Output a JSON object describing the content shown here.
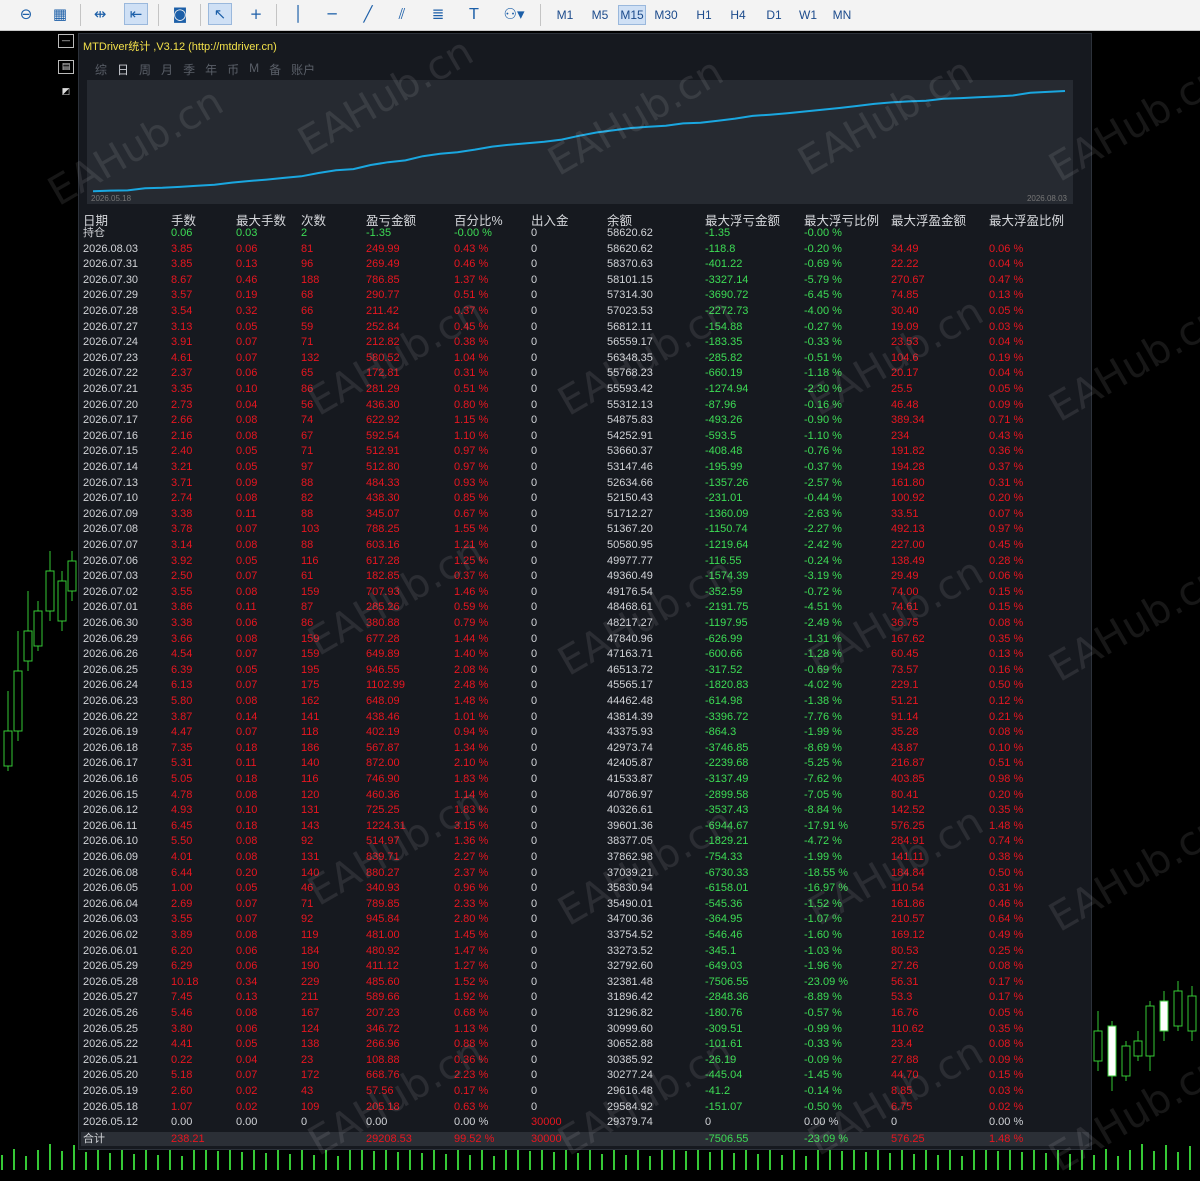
{
  "toolbar": {
    "timeframes": [
      "M1",
      "M5",
      "M15",
      "M30",
      "H1",
      "H4",
      "D1",
      "W1",
      "MN"
    ],
    "active_timeframe": "M15"
  },
  "panel": {
    "title": "MTDriver统计 ,V3.12 (http://mtdriver.cn)",
    "tabs": [
      "综",
      "日",
      "周",
      "月",
      "季",
      "年",
      "币",
      "M",
      "备",
      "账户"
    ],
    "active_tab": "日",
    "equity_start_date": "2026.05.18",
    "equity_end_date": "2026.08.03",
    "equity_color": "#1aa7e0"
  },
  "table": {
    "headers": [
      "日期",
      "手数",
      "最大手数",
      "次数",
      "盈亏金额",
      "百分比%",
      "出入金",
      "余额",
      "最大浮亏金额",
      "最大浮亏比例",
      "最大浮盈金额",
      "最大浮盈比例"
    ],
    "holding": {
      "label": "持仓",
      "lots": "0.06",
      "max_lots": "0.03",
      "count": "2",
      "pl": "-1.35",
      "pct": "-0.00 %",
      "deposit": "0",
      "balance": "58620.62",
      "max_dd": "-1.35",
      "max_dd_pct": "-0.00 %"
    },
    "rows": [
      {
        "date": "2026.08.03",
        "lots": "3.85",
        "max": "0.06",
        "cnt": "81",
        "pl": "249.99",
        "pct": "0.43 %",
        "dep": "0",
        "bal": "58620.62",
        "dd": "-118.8",
        "ddp": "-0.20 %",
        "fp": "34.49",
        "fpp": "0.06 %"
      },
      {
        "date": "2026.07.31",
        "lots": "3.85",
        "max": "0.13",
        "cnt": "96",
        "pl": "269.49",
        "pct": "0.46 %",
        "dep": "0",
        "bal": "58370.63",
        "dd": "-401.22",
        "ddp": "-0.69 %",
        "fp": "22.22",
        "fpp": "0.04 %"
      },
      {
        "date": "2026.07.30",
        "lots": "8.67",
        "max": "0.46",
        "cnt": "188",
        "pl": "786.85",
        "pct": "1.37 %",
        "dep": "0",
        "bal": "58101.15",
        "dd": "-3327.14",
        "ddp": "-5.79 %",
        "fp": "270.67",
        "fpp": "0.47 %"
      },
      {
        "date": "2026.07.29",
        "lots": "3.57",
        "max": "0.19",
        "cnt": "68",
        "pl": "290.77",
        "pct": "0.51 %",
        "dep": "0",
        "bal": "57314.30",
        "dd": "-3690.72",
        "ddp": "-6.45 %",
        "fp": "74.85",
        "fpp": "0.13 %"
      },
      {
        "date": "2026.07.28",
        "lots": "3.54",
        "max": "0.32",
        "cnt": "66",
        "pl": "211.42",
        "pct": "0.37 %",
        "dep": "0",
        "bal": "57023.53",
        "dd": "-2272.73",
        "ddp": "-4.00 %",
        "fp": "30.40",
        "fpp": "0.05 %"
      },
      {
        "date": "2026.07.27",
        "lots": "3.13",
        "max": "0.05",
        "cnt": "59",
        "pl": "252.84",
        "pct": "0.45 %",
        "dep": "0",
        "bal": "56812.11",
        "dd": "-154.88",
        "ddp": "-0.27 %",
        "fp": "19.09",
        "fpp": "0.03 %"
      },
      {
        "date": "2026.07.24",
        "lots": "3.91",
        "max": "0.07",
        "cnt": "71",
        "pl": "212.82",
        "pct": "0.38 %",
        "dep": "0",
        "bal": "56559.17",
        "dd": "-183.35",
        "ddp": "-0.33 %",
        "fp": "23.53",
        "fpp": "0.04 %"
      },
      {
        "date": "2026.07.23",
        "lots": "4.61",
        "max": "0.07",
        "cnt": "132",
        "pl": "580.52",
        "pct": "1.04 %",
        "dep": "0",
        "bal": "56348.35",
        "dd": "-285.82",
        "ddp": "-0.51 %",
        "fp": "104.6",
        "fpp": "0.19 %"
      },
      {
        "date": "2026.07.22",
        "lots": "2.37",
        "max": "0.06",
        "cnt": "65",
        "pl": "172.81",
        "pct": "0.31 %",
        "dep": "0",
        "bal": "55768.23",
        "dd": "-660.19",
        "ddp": "-1.18 %",
        "fp": "20.17",
        "fpp": "0.04 %"
      },
      {
        "date": "2026.07.21",
        "lots": "3.35",
        "max": "0.10",
        "cnt": "86",
        "pl": "281.29",
        "pct": "0.51 %",
        "dep": "0",
        "bal": "55593.42",
        "dd": "-1274.94",
        "ddp": "-2.30 %",
        "fp": "25.5",
        "fpp": "0.05 %"
      },
      {
        "date": "2026.07.20",
        "lots": "2.73",
        "max": "0.04",
        "cnt": "56",
        "pl": "436.30",
        "pct": "0.80 %",
        "dep": "0",
        "bal": "55312.13",
        "dd": "-87.96",
        "ddp": "-0.16 %",
        "fp": "46.48",
        "fpp": "0.09 %"
      },
      {
        "date": "2026.07.17",
        "lots": "2.66",
        "max": "0.08",
        "cnt": "74",
        "pl": "622.92",
        "pct": "1.15 %",
        "dep": "0",
        "bal": "54875.83",
        "dd": "-493.26",
        "ddp": "-0.90 %",
        "fp": "389.34",
        "fpp": "0.71 %"
      },
      {
        "date": "2026.07.16",
        "lots": "2.16",
        "max": "0.08",
        "cnt": "67",
        "pl": "592.54",
        "pct": "1.10 %",
        "dep": "0",
        "bal": "54252.91",
        "dd": "-593.5",
        "ddp": "-1.10 %",
        "fp": "234",
        "fpp": "0.43 %"
      },
      {
        "date": "2026.07.15",
        "lots": "2.40",
        "max": "0.05",
        "cnt": "71",
        "pl": "512.91",
        "pct": "0.97 %",
        "dep": "0",
        "bal": "53660.37",
        "dd": "-408.48",
        "ddp": "-0.76 %",
        "fp": "191.82",
        "fpp": "0.36 %"
      },
      {
        "date": "2026.07.14",
        "lots": "3.21",
        "max": "0.05",
        "cnt": "97",
        "pl": "512.80",
        "pct": "0.97 %",
        "dep": "0",
        "bal": "53147.46",
        "dd": "-195.99",
        "ddp": "-0.37 %",
        "fp": "194.28",
        "fpp": "0.37 %"
      },
      {
        "date": "2026.07.13",
        "lots": "3.71",
        "max": "0.09",
        "cnt": "88",
        "pl": "484.33",
        "pct": "0.93 %",
        "dep": "0",
        "bal": "52634.66",
        "dd": "-1357.26",
        "ddp": "-2.57 %",
        "fp": "161.80",
        "fpp": "0.31 %"
      },
      {
        "date": "2026.07.10",
        "lots": "2.74",
        "max": "0.08",
        "cnt": "82",
        "pl": "438.30",
        "pct": "0.85 %",
        "dep": "0",
        "bal": "52150.43",
        "dd": "-231.01",
        "ddp": "-0.44 %",
        "fp": "100.92",
        "fpp": "0.20 %"
      },
      {
        "date": "2026.07.09",
        "lots": "3.38",
        "max": "0.11",
        "cnt": "88",
        "pl": "345.07",
        "pct": "0.67 %",
        "dep": "0",
        "bal": "51712.27",
        "dd": "-1360.09",
        "ddp": "-2.63 %",
        "fp": "33.51",
        "fpp": "0.07 %"
      },
      {
        "date": "2026.07.08",
        "lots": "3.78",
        "max": "0.07",
        "cnt": "103",
        "pl": "788.25",
        "pct": "1.55 %",
        "dep": "0",
        "bal": "51367.20",
        "dd": "-1150.74",
        "ddp": "-2.27 %",
        "fp": "492.13",
        "fpp": "0.97 %"
      },
      {
        "date": "2026.07.07",
        "lots": "3.14",
        "max": "0.08",
        "cnt": "88",
        "pl": "603.16",
        "pct": "1.21 %",
        "dep": "0",
        "bal": "50580.95",
        "dd": "-1219.64",
        "ddp": "-2.42 %",
        "fp": "227.00",
        "fpp": "0.45 %"
      },
      {
        "date": "2026.07.06",
        "lots": "3.92",
        "max": "0.05",
        "cnt": "116",
        "pl": "617.28",
        "pct": "1.25 %",
        "dep": "0",
        "bal": "49977.77",
        "dd": "-116.55",
        "ddp": "-0.24 %",
        "fp": "138.49",
        "fpp": "0.28 %"
      },
      {
        "date": "2026.07.03",
        "lots": "2.50",
        "max": "0.07",
        "cnt": "61",
        "pl": "182.85",
        "pct": "0.37 %",
        "dep": "0",
        "bal": "49360.49",
        "dd": "-1574.39",
        "ddp": "-3.19 %",
        "fp": "29.49",
        "fpp": "0.06 %"
      },
      {
        "date": "2026.07.02",
        "lots": "3.55",
        "max": "0.08",
        "cnt": "159",
        "pl": "707.93",
        "pct": "1.46 %",
        "dep": "0",
        "bal": "49176.54",
        "dd": "-352.59",
        "ddp": "-0.72 %",
        "fp": "74.00",
        "fpp": "0.15 %"
      },
      {
        "date": "2026.07.01",
        "lots": "3.86",
        "max": "0.11",
        "cnt": "87",
        "pl": "285.26",
        "pct": "0.59 %",
        "dep": "0",
        "bal": "48468.61",
        "dd": "-2191.75",
        "ddp": "-4.51 %",
        "fp": "74.61",
        "fpp": "0.15 %"
      },
      {
        "date": "2026.06.30",
        "lots": "3.38",
        "max": "0.06",
        "cnt": "86",
        "pl": "380.88",
        "pct": "0.79 %",
        "dep": "0",
        "bal": "48217.27",
        "dd": "-1197.95",
        "ddp": "-2.49 %",
        "fp": "36.75",
        "fpp": "0.08 %"
      },
      {
        "date": "2026.06.29",
        "lots": "3.66",
        "max": "0.08",
        "cnt": "159",
        "pl": "677.28",
        "pct": "1.44 %",
        "dep": "0",
        "bal": "47840.96",
        "dd": "-626.99",
        "ddp": "-1.31 %",
        "fp": "167.62",
        "fpp": "0.35 %"
      },
      {
        "date": "2026.06.26",
        "lots": "4.54",
        "max": "0.07",
        "cnt": "159",
        "pl": "649.89",
        "pct": "1.40 %",
        "dep": "0",
        "bal": "47163.71",
        "dd": "-600.66",
        "ddp": "-1.28 %",
        "fp": "60.45",
        "fpp": "0.13 %"
      },
      {
        "date": "2026.06.25",
        "lots": "6.39",
        "max": "0.05",
        "cnt": "195",
        "pl": "946.55",
        "pct": "2.08 %",
        "dep": "0",
        "bal": "46513.72",
        "dd": "-317.52",
        "ddp": "-0.69 %",
        "fp": "73.57",
        "fpp": "0.16 %"
      },
      {
        "date": "2026.06.24",
        "lots": "6.13",
        "max": "0.07",
        "cnt": "175",
        "pl": "1102.99",
        "pct": "2.48 %",
        "dep": "0",
        "bal": "45565.17",
        "dd": "-1820.83",
        "ddp": "-4.02 %",
        "fp": "229.1",
        "fpp": "0.50 %"
      },
      {
        "date": "2026.06.23",
        "lots": "5.80",
        "max": "0.08",
        "cnt": "162",
        "pl": "648.09",
        "pct": "1.48 %",
        "dep": "0",
        "bal": "44462.48",
        "dd": "-614.98",
        "ddp": "-1.38 %",
        "fp": "51.21",
        "fpp": "0.12 %"
      },
      {
        "date": "2026.06.22",
        "lots": "3.87",
        "max": "0.14",
        "cnt": "141",
        "pl": "438.46",
        "pct": "1.01 %",
        "dep": "0",
        "bal": "43814.39",
        "dd": "-3396.72",
        "ddp": "-7.76 %",
        "fp": "91.14",
        "fpp": "0.21 %"
      },
      {
        "date": "2026.06.19",
        "lots": "4.47",
        "max": "0.07",
        "cnt": "118",
        "pl": "402.19",
        "pct": "0.94 %",
        "dep": "0",
        "bal": "43375.93",
        "dd": "-864.3",
        "ddp": "-1.99 %",
        "fp": "35.28",
        "fpp": "0.08 %"
      },
      {
        "date": "2026.06.18",
        "lots": "7.35",
        "max": "0.18",
        "cnt": "186",
        "pl": "567.87",
        "pct": "1.34 %",
        "dep": "0",
        "bal": "42973.74",
        "dd": "-3746.85",
        "ddp": "-8.69 %",
        "fp": "43.87",
        "fpp": "0.10 %"
      },
      {
        "date": "2026.06.17",
        "lots": "5.31",
        "max": "0.11",
        "cnt": "140",
        "pl": "872.00",
        "pct": "2.10 %",
        "dep": "0",
        "bal": "42405.87",
        "dd": "-2239.68",
        "ddp": "-5.25 %",
        "fp": "216.87",
        "fpp": "0.51 %"
      },
      {
        "date": "2026.06.16",
        "lots": "5.05",
        "max": "0.18",
        "cnt": "116",
        "pl": "746.90",
        "pct": "1.83 %",
        "dep": "0",
        "bal": "41533.87",
        "dd": "-3137.49",
        "ddp": "-7.62 %",
        "fp": "403.85",
        "fpp": "0.98 %"
      },
      {
        "date": "2026.06.15",
        "lots": "4.78",
        "max": "0.08",
        "cnt": "120",
        "pl": "460.36",
        "pct": "1.14 %",
        "dep": "0",
        "bal": "40786.97",
        "dd": "-2899.58",
        "ddp": "-7.05 %",
        "fp": "80.41",
        "fpp": "0.20 %"
      },
      {
        "date": "2026.06.12",
        "lots": "4.93",
        "max": "0.10",
        "cnt": "131",
        "pl": "725.25",
        "pct": "1.83 %",
        "dep": "0",
        "bal": "40326.61",
        "dd": "-3537.43",
        "ddp": "-8.84 %",
        "fp": "142.52",
        "fpp": "0.35 %"
      },
      {
        "date": "2026.06.11",
        "lots": "6.45",
        "max": "0.18",
        "cnt": "143",
        "pl": "1224.31",
        "pct": "3.15 %",
        "dep": "0",
        "bal": "39601.36",
        "dd": "-6944.67",
        "ddp": "-17.91 %",
        "fp": "576.25",
        "fpp": "1.48 %"
      },
      {
        "date": "2026.06.10",
        "lots": "5.50",
        "max": "0.08",
        "cnt": "92",
        "pl": "514.97",
        "pct": "1.36 %",
        "dep": "0",
        "bal": "38377.05",
        "dd": "-1829.21",
        "ddp": "-4.72 %",
        "fp": "284.91",
        "fpp": "0.74 %"
      },
      {
        "date": "2026.06.09",
        "lots": "4.01",
        "max": "0.08",
        "cnt": "131",
        "pl": "839.71",
        "pct": "2.27 %",
        "dep": "0",
        "bal": "37862.98",
        "dd": "-754.33",
        "ddp": "-1.99 %",
        "fp": "141.11",
        "fpp": "0.38 %"
      },
      {
        "date": "2026.06.08",
        "lots": "6.44",
        "max": "0.20",
        "cnt": "140",
        "pl": "880.27",
        "pct": "2.37 %",
        "dep": "0",
        "bal": "37039.21",
        "dd": "-6730.33",
        "ddp": "-18.55 %",
        "fp": "184.84",
        "fpp": "0.50 %"
      },
      {
        "date": "2026.06.05",
        "lots": "1.00",
        "max": "0.05",
        "cnt": "46",
        "pl": "340.93",
        "pct": "0.96 %",
        "dep": "0",
        "bal": "35830.94",
        "dd": "-6158.01",
        "ddp": "-16.97 %",
        "fp": "110.54",
        "fpp": "0.31 %"
      },
      {
        "date": "2026.06.04",
        "lots": "2.69",
        "max": "0.07",
        "cnt": "71",
        "pl": "789.85",
        "pct": "2.33 %",
        "dep": "0",
        "bal": "35490.01",
        "dd": "-545.36",
        "ddp": "-1.52 %",
        "fp": "161.86",
        "fpp": "0.46 %"
      },
      {
        "date": "2026.06.03",
        "lots": "3.55",
        "max": "0.07",
        "cnt": "92",
        "pl": "945.84",
        "pct": "2.80 %",
        "dep": "0",
        "bal": "34700.36",
        "dd": "-364.95",
        "ddp": "-1.07 %",
        "fp": "210.57",
        "fpp": "0.64 %"
      },
      {
        "date": "2026.06.02",
        "lots": "3.89",
        "max": "0.08",
        "cnt": "119",
        "pl": "481.00",
        "pct": "1.45 %",
        "dep": "0",
        "bal": "33754.52",
        "dd": "-546.46",
        "ddp": "-1.60 %",
        "fp": "169.12",
        "fpp": "0.49 %"
      },
      {
        "date": "2026.06.01",
        "lots": "6.20",
        "max": "0.06",
        "cnt": "184",
        "pl": "480.92",
        "pct": "1.47 %",
        "dep": "0",
        "bal": "33273.52",
        "dd": "-345.1",
        "ddp": "-1.03 %",
        "fp": "80.53",
        "fpp": "0.25 %"
      },
      {
        "date": "2026.05.29",
        "lots": "6.29",
        "max": "0.06",
        "cnt": "190",
        "pl": "411.12",
        "pct": "1.27 %",
        "dep": "0",
        "bal": "32792.60",
        "dd": "-649.03",
        "ddp": "-1.96 %",
        "fp": "27.26",
        "fpp": "0.08 %"
      },
      {
        "date": "2026.05.28",
        "lots": "10.18",
        "max": "0.34",
        "cnt": "229",
        "pl": "485.60",
        "pct": "1.52 %",
        "dep": "0",
        "bal": "32381.48",
        "dd": "-7506.55",
        "ddp": "-23.09 %",
        "fp": "56.31",
        "fpp": "0.17 %"
      },
      {
        "date": "2026.05.27",
        "lots": "7.45",
        "max": "0.13",
        "cnt": "211",
        "pl": "589.66",
        "pct": "1.92 %",
        "dep": "0",
        "bal": "31896.42",
        "dd": "-2848.36",
        "ddp": "-8.89 %",
        "fp": "53.3",
        "fpp": "0.17 %"
      },
      {
        "date": "2026.05.26",
        "lots": "5.46",
        "max": "0.08",
        "cnt": "167",
        "pl": "207.23",
        "pct": "0.68 %",
        "dep": "0",
        "bal": "31296.82",
        "dd": "-180.76",
        "ddp": "-0.57 %",
        "fp": "16.76",
        "fpp": "0.05 %"
      },
      {
        "date": "2026.05.25",
        "lots": "3.80",
        "max": "0.06",
        "cnt": "124",
        "pl": "346.72",
        "pct": "1.13 %",
        "dep": "0",
        "bal": "30999.60",
        "dd": "-309.51",
        "ddp": "-0.99 %",
        "fp": "110.62",
        "fpp": "0.35 %"
      },
      {
        "date": "2026.05.22",
        "lots": "4.41",
        "max": "0.05",
        "cnt": "138",
        "pl": "266.96",
        "pct": "0.88 %",
        "dep": "0",
        "bal": "30652.88",
        "dd": "-101.61",
        "ddp": "-0.33 %",
        "fp": "23.4",
        "fpp": "0.08 %"
      },
      {
        "date": "2026.05.21",
        "lots": "0.22",
        "max": "0.04",
        "cnt": "23",
        "pl": "108.88",
        "pct": "0.36 %",
        "dep": "0",
        "bal": "30385.92",
        "dd": "-26.19",
        "ddp": "-0.09 %",
        "fp": "27.88",
        "fpp": "0.09 %"
      },
      {
        "date": "2026.05.20",
        "lots": "5.18",
        "max": "0.07",
        "cnt": "172",
        "pl": "668.76",
        "pct": "2.23 %",
        "dep": "0",
        "bal": "30277.24",
        "dd": "-445.04",
        "ddp": "-1.45 %",
        "fp": "44.70",
        "fpp": "0.15 %"
      },
      {
        "date": "2026.05.19",
        "lots": "2.60",
        "max": "0.02",
        "cnt": "43",
        "pl": "57.56",
        "pct": "0.17 %",
        "dep": "0",
        "bal": "29616.48",
        "dd": "-41.2",
        "ddp": "-0.14 %",
        "fp": "8.85",
        "fpp": "0.03 %"
      },
      {
        "date": "2026.05.18",
        "lots": "1.07",
        "max": "0.02",
        "cnt": "109",
        "pl": "205.18",
        "pct": "0.63 %",
        "dep": "0",
        "bal": "29584.92",
        "dd": "-151.07",
        "ddp": "-0.50 %",
        "fp": "6.75",
        "fpp": "0.02 %"
      }
    ],
    "first_row": {
      "date": "2026.05.12",
      "lots": "0.00",
      "max": "0.00",
      "cnt": "0",
      "pl": "0.00",
      "pct": "0.00 %",
      "dep": "30000",
      "bal": "29379.74",
      "dd": "0",
      "ddp": "0.00 %",
      "fp": "0",
      "fpp": "0.00 %"
    },
    "total": {
      "label": "合计",
      "lots": "238.21",
      "pl": "29208.53",
      "pct": "99.52 %",
      "dep": "30000",
      "dd": "-7506.55",
      "ddp": "-23.09 %",
      "fp": "576.25",
      "fpp": "1.48 %"
    }
  },
  "colors": {
    "profit": "#e81620",
    "drawdown": "#3ddc55",
    "text": "#d2d4d8",
    "title": "#f2e04a"
  }
}
